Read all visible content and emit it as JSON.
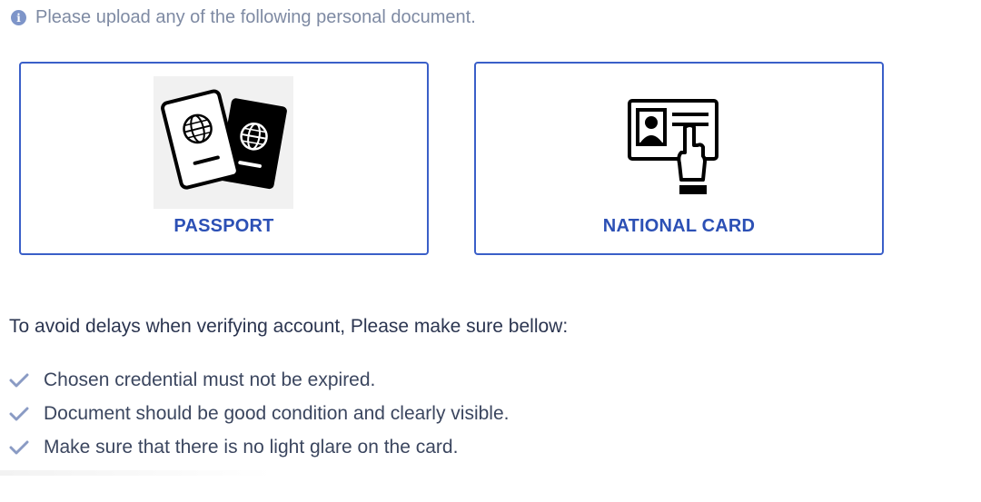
{
  "notice": {
    "icon": "info-icon",
    "text": "Please upload any of the following personal document."
  },
  "documents": [
    {
      "id": "passport",
      "label": "PASSPORT",
      "icon": "passport-icon"
    },
    {
      "id": "national_card",
      "label": "NATIONAL CARD",
      "icon": "id-card-icon"
    }
  ],
  "requirements": {
    "title": "To avoid delays when verifying account, Please make sure bellow:",
    "items": [
      "Chosen credential must not be expired.",
      "Document should be good condition and clearly visible.",
      "Make sure that there is no light glare on the card."
    ],
    "icon": "check-icon"
  },
  "colors": {
    "accent": "#3a5fc8",
    "label": "#2c50b5",
    "muted": "#7e8aa3",
    "text": "#2b3550"
  }
}
